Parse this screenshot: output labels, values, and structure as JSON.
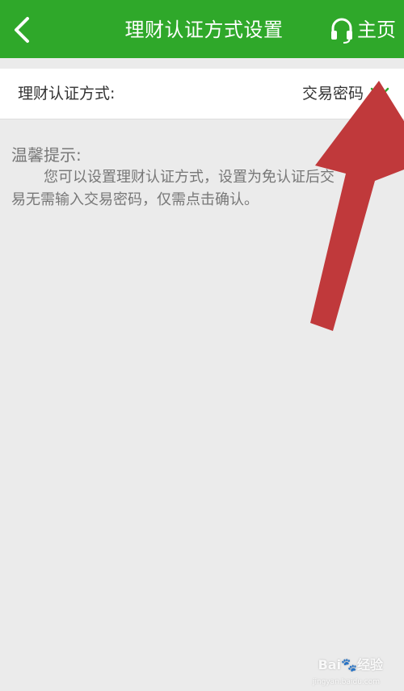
{
  "header": {
    "title": "理财认证方式设置",
    "home_label": "主页",
    "back_icon": "chevron-left-icon",
    "home_icon": "headset-icon"
  },
  "setting": {
    "label": "理财认证方式:",
    "value": "交易密码",
    "dropdown_icon": "chevron-down-icon"
  },
  "tips": {
    "title": "温馨提示:",
    "body": "您可以设置理财认证方式，设置为免认证后交易无需输入交易密码，仅需点击确认。"
  },
  "watermark": {
    "text": "Bai🐾经验",
    "sub": "jingyan.baidu.com"
  },
  "colors": {
    "header_green": "#2fa82a",
    "accent_green": "#2fa82a",
    "background": "#ebebeb",
    "arrow_red": "#c0393b"
  }
}
